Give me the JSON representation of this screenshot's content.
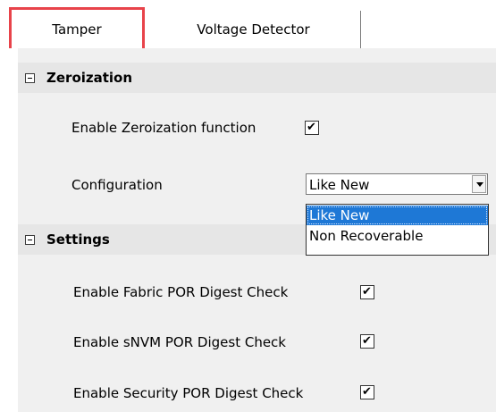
{
  "tabs": [
    {
      "label": "Tamper",
      "active": true
    },
    {
      "label": "Voltage Detector",
      "active": false
    }
  ],
  "sections": {
    "zeroization": {
      "title": "Zeroization",
      "enable_label": "Enable Zeroization function",
      "enable_checked": true,
      "config_label": "Configuration",
      "config_value": "Like New",
      "config_options": [
        "Like New",
        "Non Recoverable"
      ]
    },
    "settings": {
      "title": "Settings",
      "items": [
        {
          "label": "Enable Fabric POR Digest Check",
          "checked": true
        },
        {
          "label": "Enable sNVM POR Digest Check",
          "checked": true
        },
        {
          "label": "Enable Security POR Digest Check",
          "checked": true
        }
      ]
    }
  },
  "icons": {
    "check": "✔",
    "collapse": "minus-box"
  },
  "colors": {
    "active_tab_highlight": "#e8434a",
    "selected_option_bg": "#1e78d6",
    "panel_bg": "#f0f0f0",
    "section_header_bg": "#e6e6e6"
  }
}
